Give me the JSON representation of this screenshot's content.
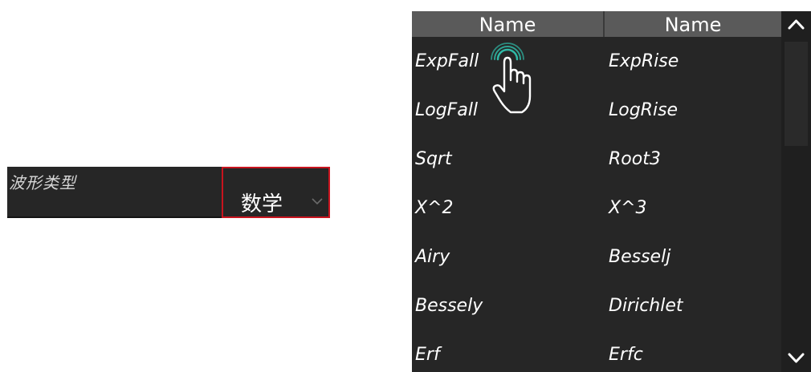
{
  "waveform": {
    "label": "波形类型",
    "selected": "数学"
  },
  "list": {
    "columns": [
      "Name",
      "Name"
    ],
    "rows": [
      [
        "ExpFall",
        "ExpRise"
      ],
      [
        "LogFall",
        "LogRise"
      ],
      [
        "Sqrt",
        "Root3"
      ],
      [
        "X^2",
        "X^3"
      ],
      [
        "Airy",
        "Besselj"
      ],
      [
        "Bessely",
        "Dirichlet"
      ],
      [
        "Erf",
        "Erfc"
      ]
    ]
  },
  "icons": {
    "dropdown": "chevron-down-icon",
    "scroll_up": "chevron-up-icon",
    "scroll_down": "chevron-down-icon",
    "cursor": "hand-pointer-icon"
  },
  "colors": {
    "panel_bg": "#262626",
    "header_bg": "#5a5a5a",
    "highlight_border": "#c8141e",
    "cursor_ripple": "#2fb9a6"
  }
}
